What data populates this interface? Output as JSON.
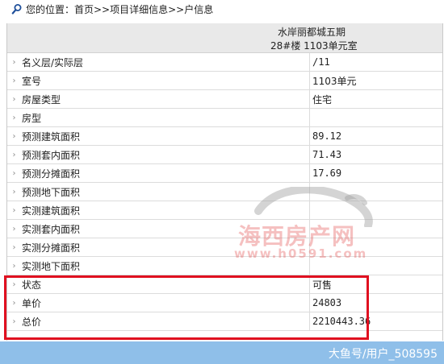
{
  "breadcrumb": {
    "icon": "search-icon",
    "text": "您的位置：首页>>项目详细信息>>户信息"
  },
  "header": {
    "title": "水岸丽都城五期",
    "subtitle": "28#楼  1103单元室"
  },
  "rows": [
    {
      "label": "名义层/实际层",
      "value": "/11"
    },
    {
      "label": "室号",
      "value": "1103单元"
    },
    {
      "label": "房屋类型",
      "value": "住宅"
    },
    {
      "label": "房型",
      "value": ""
    },
    {
      "label": "预测建筑面积",
      "value": "89.12"
    },
    {
      "label": "预测套内面积",
      "value": "71.43"
    },
    {
      "label": "预测分摊面积",
      "value": "17.69"
    },
    {
      "label": "预测地下面积",
      "value": ""
    },
    {
      "label": "实测建筑面积",
      "value": ""
    },
    {
      "label": "实测套内面积",
      "value": ""
    },
    {
      "label": "实测分摊面积",
      "value": ""
    },
    {
      "label": "实测地下面积",
      "value": ""
    },
    {
      "label": "状态",
      "value": "可售"
    },
    {
      "label": "单价",
      "value": "24803"
    },
    {
      "label": "总价",
      "value": "2210443.36"
    }
  ],
  "watermark": {
    "name": "海西房产网",
    "url": "www.h0591.com"
  },
  "footer": {
    "credit": "大鱼号/用户_508595"
  },
  "colors": {
    "header_bg": "#e9e9e9",
    "highlight_border": "#e01020",
    "footer_bg": "#8fbfe9"
  }
}
